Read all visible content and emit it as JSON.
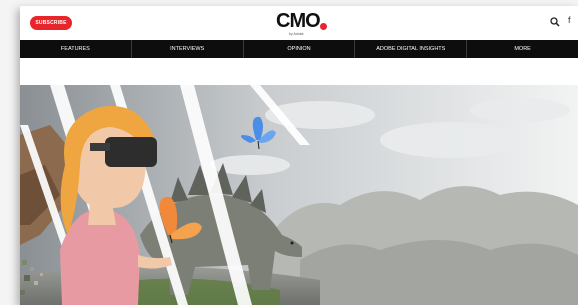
{
  "header": {
    "subscribe_label": "SUBSCRIBE",
    "logo_text": "CMO",
    "logo_sub": "by Adobe",
    "more_glyph": "f"
  },
  "nav": {
    "items": [
      {
        "label": "FEATURES"
      },
      {
        "label": "INTERVIEWS"
      },
      {
        "label": "OPINION"
      },
      {
        "label": "ADOBE DIGITAL INSIGHTS"
      },
      {
        "label": "MORE"
      }
    ]
  },
  "colors": {
    "brand_red": "#e8252a",
    "nav_bg": "#0d0d0d",
    "hair": "#f0a640",
    "skin": "#f2c9a8",
    "butterfly_orange": "#f08a3a",
    "butterfly_blue": "#4a8ee8"
  },
  "icons": [
    "search-icon",
    "more-icon"
  ],
  "hero": {
    "description_tag": "vr-headset-woman-stegosaurus-butterflies-illustration"
  }
}
